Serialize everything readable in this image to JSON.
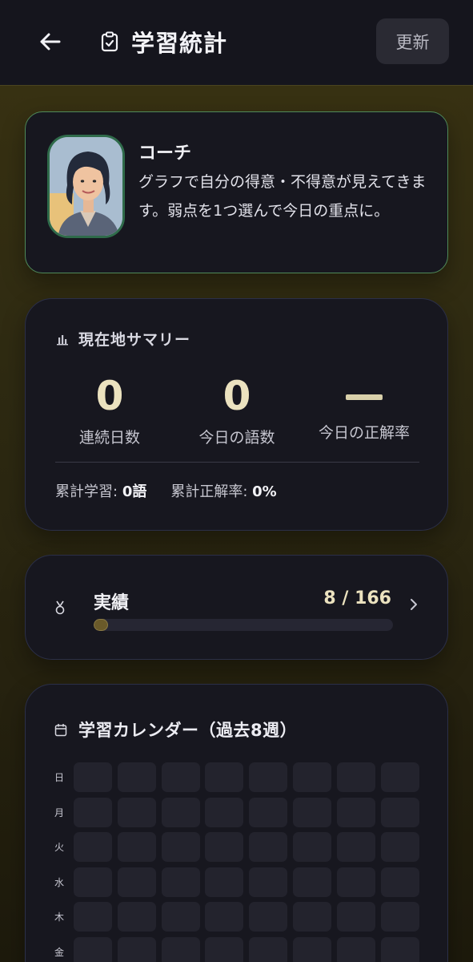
{
  "header": {
    "title": "学習統計",
    "refresh_label": "更新"
  },
  "coach": {
    "name": "コーチ",
    "message": "グラフで自分の得意・不得意が見えてきます。弱点を1つ選んで今日の重点に。"
  },
  "summary": {
    "title": "現在地サマリー",
    "stats": [
      {
        "value": "0",
        "label": "連続日数"
      },
      {
        "value": "0",
        "label": "今日の語数"
      },
      {
        "value": "—",
        "label": "今日の正解率"
      }
    ],
    "total_words_label": "累計学習:",
    "total_words_value": "0語",
    "total_accuracy_label": "累計正解率:",
    "total_accuracy_value": "0%"
  },
  "achievements": {
    "title": "実績",
    "count": "8 / 166",
    "progress": 0.048
  },
  "calendar": {
    "title": "学習カレンダー（過去8週）",
    "days": [
      "日",
      "月",
      "火",
      "水",
      "木",
      "金"
    ]
  },
  "colors": {
    "accent": "#ebe2bf",
    "card_bg": "#17171f",
    "coach_border": "#4f8a5a"
  }
}
